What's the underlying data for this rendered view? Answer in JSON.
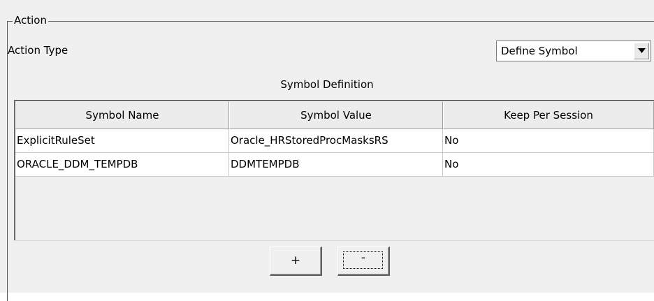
{
  "group": {
    "title": "Action"
  },
  "action_type": {
    "label": "Action Type",
    "selected": "Define Symbol"
  },
  "symbol_definition": {
    "title": "Symbol Definition",
    "columns": [
      "Symbol Name",
      "Symbol Value",
      "Keep Per Session"
    ],
    "rows": [
      [
        "ExplicitRuleSet",
        "Oracle_HRStoredProcMasksRS",
        "No"
      ],
      [
        "ORACLE_DDM_TEMPDB",
        "DDMTEMPDB",
        "No"
      ]
    ]
  },
  "buttons": {
    "add_label": "+",
    "remove_label": "-"
  },
  "icons": {
    "combo_arrow": "chevron-down-icon"
  },
  "colors": {
    "panel_bg": "#f0f0f0",
    "table_bg": "#ffffff",
    "border_dark": "#5a5a5a"
  }
}
